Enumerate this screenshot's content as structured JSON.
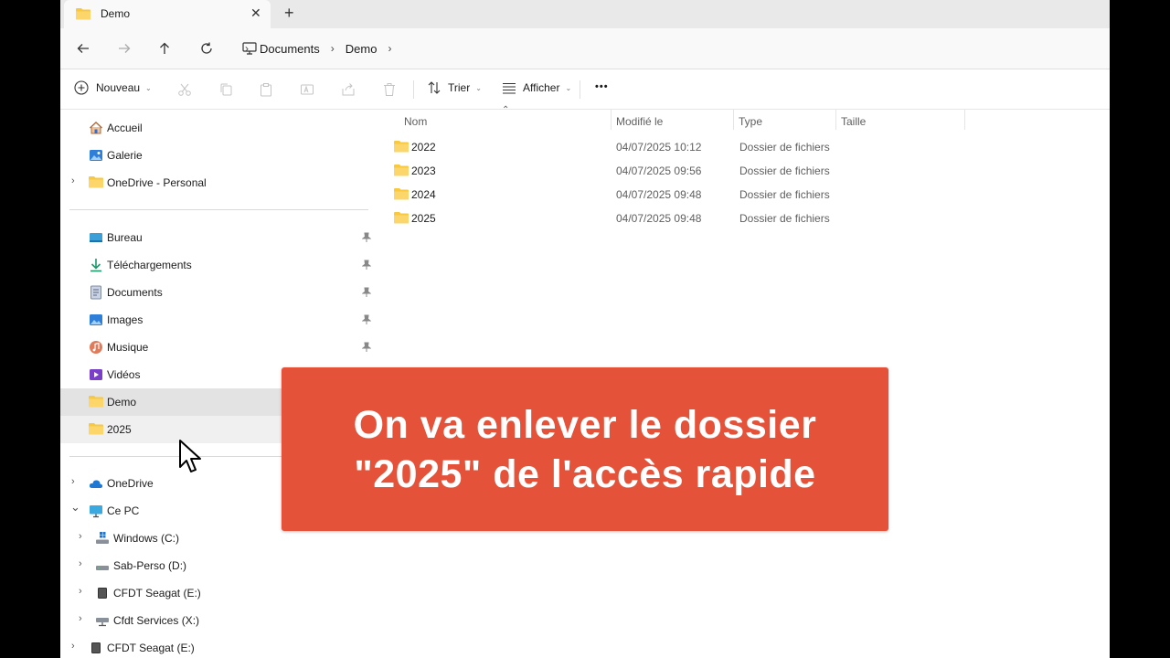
{
  "tab": {
    "title": "Demo",
    "close_glyph": "✕",
    "new_tab_glyph": "+"
  },
  "breadcrumbs": [
    "Documents",
    "Demo"
  ],
  "toolbar": {
    "new_label": "Nouveau",
    "sort_label": "Trier",
    "view_label": "Afficher",
    "more_glyph": "•••"
  },
  "sidebar": {
    "top": [
      {
        "label": "Accueil",
        "icon": "home-icon"
      },
      {
        "label": "Galerie",
        "icon": "gallery-icon"
      },
      {
        "label": "OneDrive - Personal",
        "icon": "folder-icon",
        "expandable": true
      }
    ],
    "pinned": [
      {
        "label": "Bureau",
        "icon": "desktop-icon"
      },
      {
        "label": "Téléchargements",
        "icon": "download-icon"
      },
      {
        "label": "Documents",
        "icon": "documents-icon"
      },
      {
        "label": "Images",
        "icon": "images-icon"
      },
      {
        "label": "Musique",
        "icon": "music-icon"
      },
      {
        "label": "Vidéos",
        "icon": "videos-icon"
      },
      {
        "label": "Demo",
        "icon": "folder-icon",
        "selected": true
      },
      {
        "label": "2025",
        "icon": "folder-icon",
        "hovered": true
      }
    ],
    "drives": [
      {
        "label": "OneDrive",
        "icon": "cloud-icon",
        "chevron": "›"
      },
      {
        "label": "Ce PC",
        "icon": "pc-icon",
        "chevron": "⌄"
      },
      {
        "label": "Windows (C:)",
        "icon": "drive-icon",
        "chevron": "›"
      },
      {
        "label": "Sab-Perso (D:)",
        "icon": "drive-icon",
        "chevron": "›"
      },
      {
        "label": "CFDT Seagat (E:)",
        "icon": "drive-icon",
        "chevron": "›"
      },
      {
        "label": "Cfdt Services (X:)",
        "icon": "network-drive-icon",
        "chevron": "›"
      },
      {
        "label": "CFDT Seagat (E:)",
        "icon": "drive-icon",
        "chevron": "›"
      }
    ]
  },
  "columns": {
    "name": "Nom",
    "modified": "Modifié le",
    "type": "Type",
    "size": "Taille"
  },
  "files": [
    {
      "name": "2022",
      "modified": "04/07/2025 10:12",
      "type": "Dossier de fichiers"
    },
    {
      "name": "2023",
      "modified": "04/07/2025 09:56",
      "type": "Dossier de fichiers"
    },
    {
      "name": "2024",
      "modified": "04/07/2025 09:48",
      "type": "Dossier de fichiers"
    },
    {
      "name": "2025",
      "modified": "04/07/2025 09:48",
      "type": "Dossier de fichiers"
    }
  ],
  "overlay": {
    "line1": "On va enlever le dossier",
    "line2": "\"2025\" de l'accès rapide"
  },
  "colors": {
    "banner": "#e4523a",
    "folder": "#f8c83f"
  }
}
